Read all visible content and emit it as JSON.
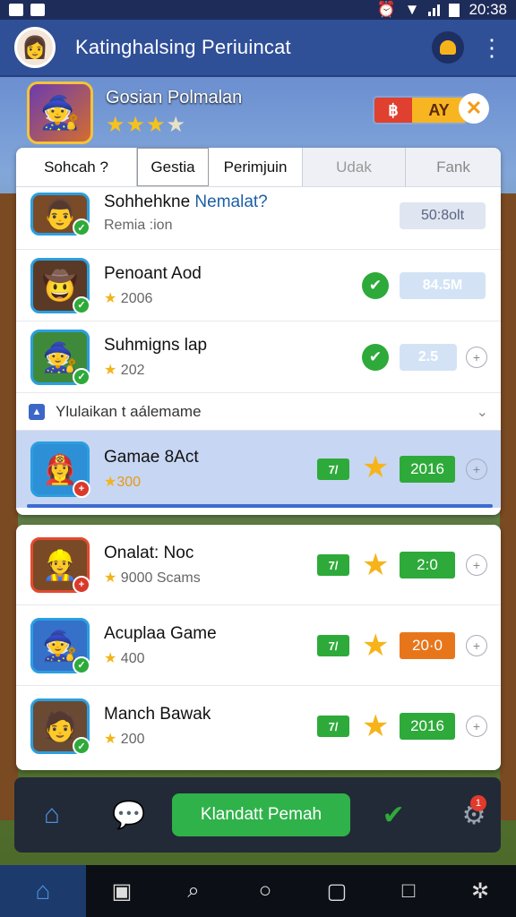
{
  "status": {
    "time": "20:38"
  },
  "appbar": {
    "title": "Katinghalsing Periuincat"
  },
  "featured": {
    "title": "Gosian Polmalan",
    "stars": "★★★",
    "star_dim": "★",
    "btn_red": "฿",
    "btn_yellow": "AY",
    "close": "✕"
  },
  "tabs": [
    "Sohcah ?",
    "Gestia",
    "Perimjuin",
    "Udak",
    "Fank"
  ],
  "list1": [
    {
      "name_a": "Sohhehkne ",
      "name_b": "Nemalat?",
      "sub": "Remia :ion",
      "pill": "50:8olt",
      "icon": "👨"
    },
    {
      "name": "Penoant Aod",
      "rating": "2006",
      "pill": "84.5M",
      "icon": "🤠"
    },
    {
      "name": "Suhmigns lap",
      "rating": "202",
      "pill": "2.5",
      "icon": "🧙"
    }
  ],
  "section": {
    "label": "Ylulaikan t aálemame"
  },
  "selected": {
    "name": "Gamae 8Act",
    "rating": "300",
    "score": "2016",
    "badge": "7/",
    "icon": "👩‍🚒"
  },
  "list2": [
    {
      "name": "Onalat: Noc",
      "sub": "9000 Scams",
      "score": "2:0",
      "color": "#2eaa3a",
      "badge": "7/",
      "icon": "👷"
    },
    {
      "name": "Acuplaa Game",
      "sub": "400",
      "score": "20·0",
      "color": "#e7761b",
      "badge": "7/",
      "icon": "🧙"
    },
    {
      "name": "Manch Bawak",
      "sub": "200",
      "score": "2016",
      "color": "#2eaa3a",
      "badge": "7/",
      "icon": "🧑"
    }
  ],
  "bottom": {
    "cta": "Klandatt Pemah",
    "notif": "1"
  }
}
